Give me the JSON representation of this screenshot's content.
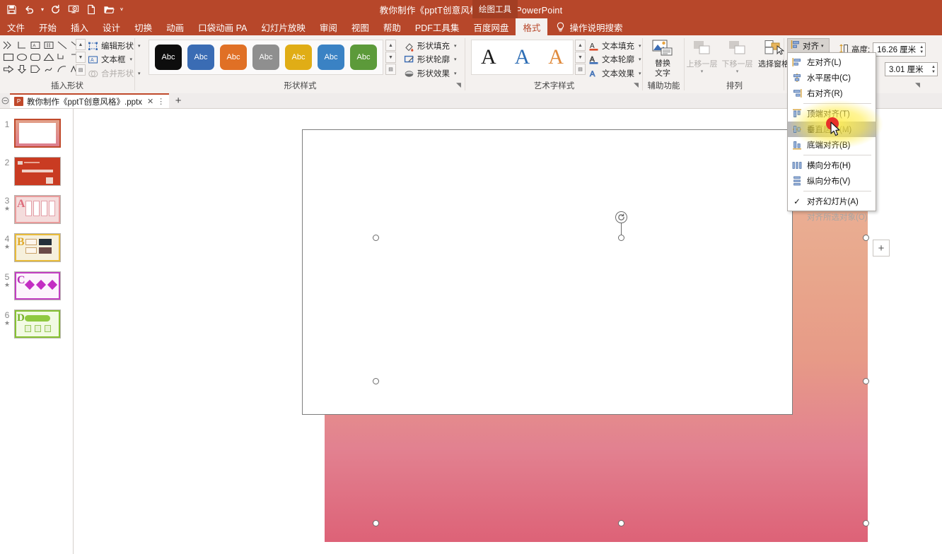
{
  "titlebar": {
    "document_title": "教你制作《pptT创意风格》.pptx  -  PowerPoint",
    "contextual_tab_label": "绘图工具",
    "qat": [
      {
        "name": "save-icon",
        "label": "保存"
      },
      {
        "name": "undo-icon",
        "label": "撤消"
      },
      {
        "name": "undo-dropdown-caret-icon",
        "label": "撤消下拉"
      },
      {
        "name": "redo-icon",
        "label": "恢复"
      },
      {
        "name": "start-from-beginning-icon",
        "label": "从头开始"
      },
      {
        "name": "new-file-icon",
        "label": "新建"
      },
      {
        "name": "open-folder-icon",
        "label": "打开"
      },
      {
        "name": "customize-qat-icon",
        "label": "自定义快速访问工具栏"
      }
    ]
  },
  "ribbon_tabs": {
    "items": [
      {
        "label": "文件",
        "active": false
      },
      {
        "label": "开始",
        "active": false
      },
      {
        "label": "插入",
        "active": false
      },
      {
        "label": "设计",
        "active": false
      },
      {
        "label": "切换",
        "active": false
      },
      {
        "label": "动画",
        "active": false
      },
      {
        "label": "口袋动画 PA",
        "active": false
      },
      {
        "label": "幻灯片放映",
        "active": false
      },
      {
        "label": "审阅",
        "active": false
      },
      {
        "label": "视图",
        "active": false
      },
      {
        "label": "帮助",
        "active": false
      },
      {
        "label": "PDF工具集",
        "active": false
      },
      {
        "label": "百度网盘",
        "active": false
      },
      {
        "label": "格式",
        "active": true
      }
    ],
    "tell_me": "操作说明搜索"
  },
  "ribbon": {
    "groups": [
      {
        "label": "插入形状"
      },
      {
        "label": "形状样式"
      },
      {
        "label": "艺术字样式"
      },
      {
        "label": "辅助功能"
      },
      {
        "label": "排列"
      }
    ],
    "insert_shapes": {
      "edit_shape": "编辑形状",
      "text_box": "文本框",
      "merge_shapes": "合并形状",
      "shape_glyphs": [
        "≫",
        "⌐",
        "A▣",
        "▥",
        "╲",
        "↘",
        "▭",
        "◯",
        "▢",
        "△",
        "⌐",
        "⌐",
        "⇨",
        "⇩",
        "◗",
        "✎",
        "︵",
        "∧"
      ]
    },
    "shape_styles": {
      "swatches": [
        "#0d0d0d",
        "#3a6cb4",
        "#e07025",
        "#8f8f8f",
        "#e0ad16",
        "#3a82c4",
        "#5c9a3a"
      ],
      "swatch_label": "Abc",
      "shape_fill": "形状填充",
      "shape_outline": "形状轮廓",
      "shape_effects": "形状效果"
    },
    "wordart_styles": {
      "samples": [
        {
          "glyph": "A",
          "color": "#1a1a1a"
        },
        {
          "glyph": "A",
          "color": "#2e6eb5"
        },
        {
          "glyph": "A",
          "color": "#e08a3c"
        }
      ],
      "text_fill": "文本填充",
      "text_outline": "文本轮廓",
      "text_effects": "文本效果"
    },
    "accessibility": {
      "alt_text_line1": "替换",
      "alt_text_line2": "文字"
    },
    "arrange": {
      "bring_forward": "上移一层",
      "send_backward": "下移一层",
      "selection_pane": "选择窗格",
      "align_button": "对齐"
    },
    "size": {
      "height_label": "高度:",
      "height_value": "16.26 厘米",
      "width_value": "3.01 厘米"
    }
  },
  "align_menu": {
    "items": [
      {
        "label": "左对齐(L)",
        "icon": "align-left-icon",
        "state": "normal"
      },
      {
        "label": "水平居中(C)",
        "icon": "align-center-icon",
        "state": "normal"
      },
      {
        "label": "右对齐(R)",
        "icon": "align-right-icon",
        "state": "normal"
      },
      {
        "label": "顶端对齐(T)",
        "icon": "align-top-icon",
        "state": "normal"
      },
      {
        "label": "垂直居中(M)",
        "icon": "align-middle-icon",
        "state": "selected"
      },
      {
        "label": "底端对齐(B)",
        "icon": "align-bottom-icon",
        "state": "normal"
      },
      {
        "label": "横向分布(H)",
        "icon": "distribute-horizontal-icon",
        "state": "normal"
      },
      {
        "label": "纵向分布(V)",
        "icon": "distribute-vertical-icon",
        "state": "normal"
      },
      {
        "label": "对齐幻灯片(A)",
        "icon": "check-icon",
        "state": "checked"
      },
      {
        "label": "对齐所选对象(O)",
        "icon": "none",
        "state": "disabled"
      }
    ],
    "separator_after_indexes": [
      2,
      5,
      7
    ],
    "highlight_color": "#ffeb3c",
    "cursor_color": "#e8312a"
  },
  "file_tabs": {
    "open_file": "教你制作《pptT创意风格》.pptx",
    "close_glyph": "✕",
    "more_glyph": "⋮",
    "new_tab_glyph": "+"
  },
  "slide_panel": {
    "slides": [
      {
        "number": "1",
        "modified": false,
        "selected": true,
        "kind": "blank-white-on-rose"
      },
      {
        "number": "2",
        "modified": false,
        "selected": false,
        "kind": "red-title"
      },
      {
        "number": "3",
        "modified": true,
        "selected": false,
        "kind": "pink-letter-a"
      },
      {
        "number": "4",
        "modified": true,
        "selected": false,
        "kind": "yellow-letter-b"
      },
      {
        "number": "5",
        "modified": true,
        "selected": false,
        "kind": "purple-letter-c"
      },
      {
        "number": "6",
        "modified": true,
        "selected": false,
        "kind": "green-letter-d"
      }
    ],
    "modified_marker": "★"
  },
  "canvas": {
    "slide_gradient_top": "#eaae93",
    "slide_gradient_bottom": "#dd6277",
    "selected_shape_fill": "#ffffff",
    "selected_shape_outline": "#7d7d7d",
    "rotate_handle_glyph": "↻",
    "add_card_glyph": "+"
  }
}
